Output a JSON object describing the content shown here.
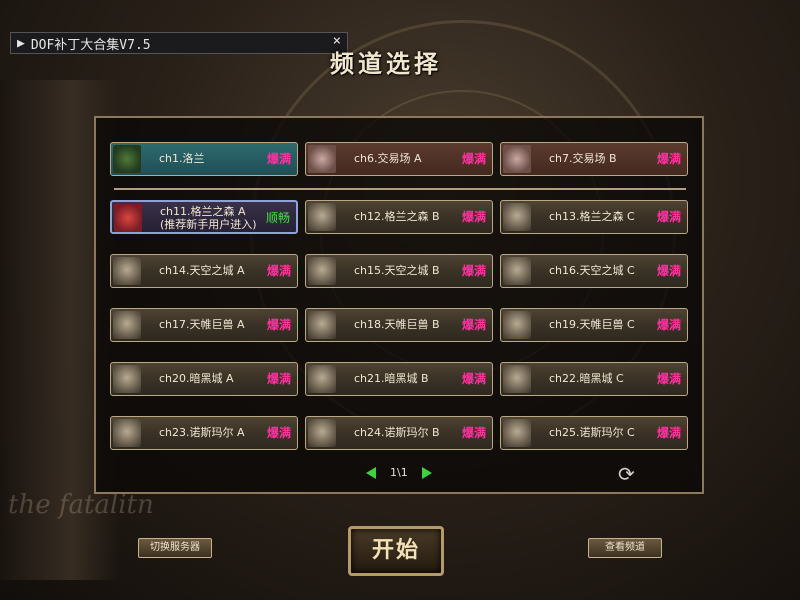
{
  "window": {
    "title": "DOF补丁大合集V7.5",
    "close_glyph": "×"
  },
  "heading": "频道选择",
  "background_text": "the fatalitn",
  "channels": [
    {
      "label": "ch1.洛兰",
      "status": "爆满",
      "thumb": "tree"
    },
    {
      "label": "ch6.交易场 A",
      "status": "爆满",
      "thumb": "pig"
    },
    {
      "label": "ch7.交易场 B",
      "status": "爆满",
      "thumb": "pig"
    },
    {
      "label": "ch11.格兰之森 A",
      "label2": "(推荐新手用户进入)",
      "status": "顺畅",
      "thumb": "girl"
    },
    {
      "label": "ch12.格兰之森 B",
      "status": "爆满",
      "thumb": "beast"
    },
    {
      "label": "ch13.格兰之森 C",
      "status": "爆满",
      "thumb": "beast"
    },
    {
      "label": "ch14.天空之城 A",
      "status": "爆满",
      "thumb": "knight"
    },
    {
      "label": "ch15.天空之城 B",
      "status": "爆满",
      "thumb": "knight"
    },
    {
      "label": "ch16.天空之城 C",
      "status": "爆满",
      "thumb": "knight"
    },
    {
      "label": "ch17.天帷巨兽 A",
      "status": "爆满",
      "thumb": "machine"
    },
    {
      "label": "ch18.天帷巨兽 B",
      "status": "爆满",
      "thumb": "machine"
    },
    {
      "label": "ch19.天帷巨兽 C",
      "status": "爆满",
      "thumb": "machine"
    },
    {
      "label": "ch20.暗黑城 A",
      "status": "爆满",
      "thumb": "demon"
    },
    {
      "label": "ch21.暗黑城 B",
      "status": "爆满",
      "thumb": "demon"
    },
    {
      "label": "ch22.暗黑城 C",
      "status": "爆满",
      "thumb": "demon"
    },
    {
      "label": "ch23.诺斯玛尔 A",
      "status": "爆满",
      "thumb": "shadow"
    },
    {
      "label": "ch24.诺斯玛尔 B",
      "status": "爆满",
      "thumb": "shadow"
    },
    {
      "label": "ch25.诺斯玛尔 C",
      "status": "爆满",
      "thumb": "shadow"
    }
  ],
  "pager": {
    "text": "1\\1"
  },
  "buttons": {
    "left": "切换服务器",
    "start": "开始",
    "right": "查看频道"
  },
  "colors": {
    "busy": "#ff2fa0",
    "smooth": "#3fe03f",
    "selected_border": "#8ea2d8"
  },
  "selected_channel": "ch11.格兰之森 A"
}
